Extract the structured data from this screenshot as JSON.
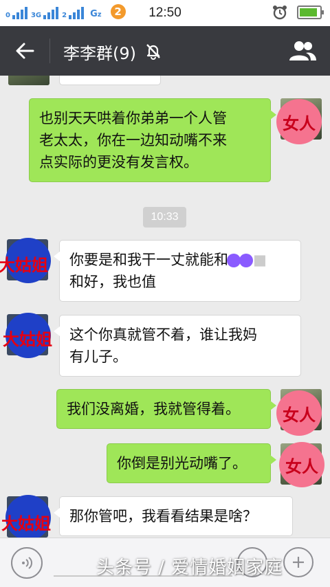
{
  "status_bar": {
    "signal_1_label": "0",
    "signal_2_label": "3G",
    "signal_3_label": "2",
    "network_label": "G",
    "network_label_z": "z",
    "notification_count": "2",
    "time": "12:50",
    "battery_level": 0.9
  },
  "header": {
    "title": "李李群(9)",
    "back_icon": "back-arrow-icon",
    "mute_icon": "bell-muted-icon",
    "group_icon": "group-members-icon",
    "bar_color": "#393a3f"
  },
  "chat": {
    "avatar_labels": {
      "woman": "女人",
      "sister": "大姑姐"
    },
    "messages": [
      {
        "side": "out",
        "sender": "女人",
        "lines": [
          "也别天天哄着你弟弟一个人管",
          "老太太，你在一边知动嘴不来",
          "点实际的更没有发言权。"
        ]
      },
      {
        "type": "time",
        "text": "10:33"
      },
      {
        "side": "in",
        "sender": "大姑姐",
        "lines_pre": "你要是和我干一丈就能和",
        "lines_post": "",
        "line2": "和好，我也值"
      },
      {
        "side": "in",
        "sender": "大姑姐",
        "lines": [
          "这个你真就管不着，谁让我妈",
          "有儿子。"
        ]
      },
      {
        "side": "out",
        "sender": "女人",
        "lines": [
          "我们没离婚，我就管得着。"
        ]
      },
      {
        "side": "out",
        "sender": "女人",
        "lines": [
          "你倒是别光动嘴了。"
        ]
      },
      {
        "side": "in",
        "sender": "大姑姐",
        "lines": [
          "那你管吧，我看看结果是啥？"
        ]
      }
    ],
    "colors": {
      "out_bubble": "#9fe658",
      "in_bubble": "#ffffff",
      "woman_badge": "#f5738f",
      "sister_badge": "#1f40c7"
    }
  },
  "input_bar": {
    "voice_icon": "voice-icon",
    "emoji_icon": "emoji-icon",
    "plus_icon": "plus-icon"
  },
  "watermark": {
    "text": "头条号 / 爱情婚姻家庭"
  }
}
